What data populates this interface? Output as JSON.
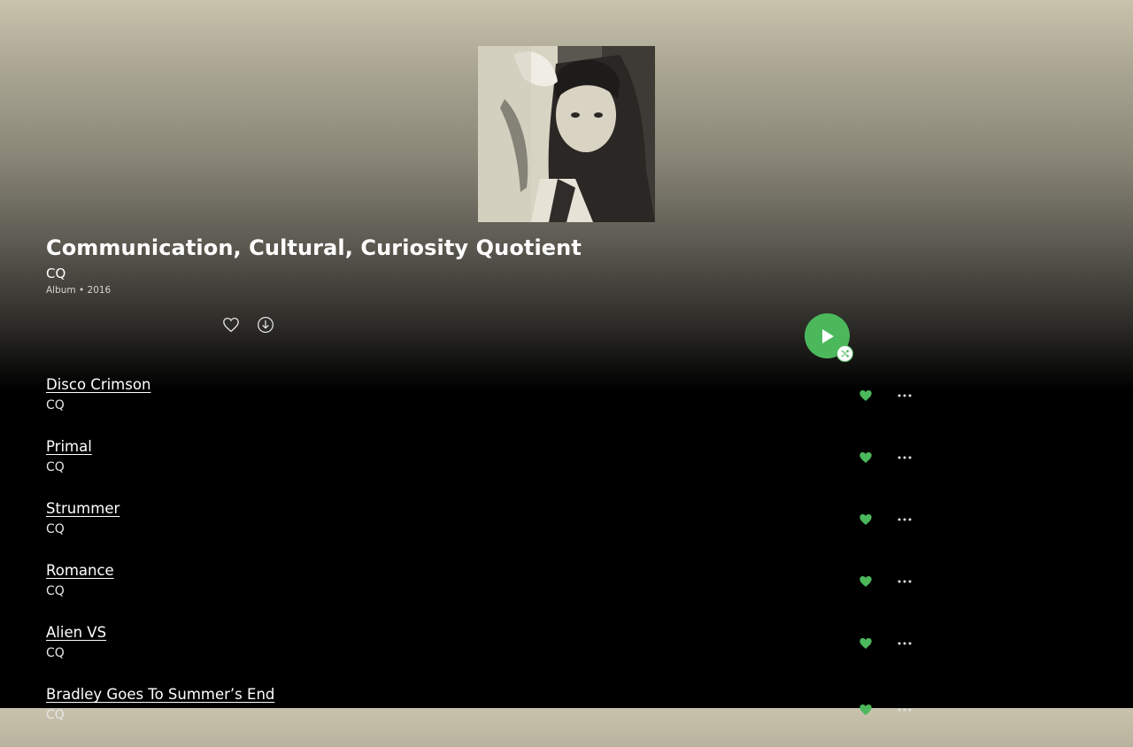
{
  "album": {
    "title": "Communication, Cultural, Curiosity Quotient",
    "artist": "CQ",
    "meta": "Album • 2016"
  },
  "actions": {
    "like_icon": "heart-outline-icon",
    "download_icon": "download-icon",
    "play_icon": "play-icon",
    "shuffle_icon": "shuffle-icon"
  },
  "tracks": [
    {
      "title": "Disco Crimson",
      "artist": "CQ",
      "liked": true
    },
    {
      "title": "Primal",
      "artist": "CQ",
      "liked": true
    },
    {
      "title": "Strummer",
      "artist": "CQ",
      "liked": true
    },
    {
      "title": "Romance",
      "artist": "CQ",
      "liked": true
    },
    {
      "title": "Alien VS",
      "artist": "CQ",
      "liked": true
    },
    {
      "title": "Bradley Goes To Summer’s End",
      "artist": "CQ",
      "liked": true
    }
  ],
  "colors": {
    "accent": "#4cb85c"
  }
}
